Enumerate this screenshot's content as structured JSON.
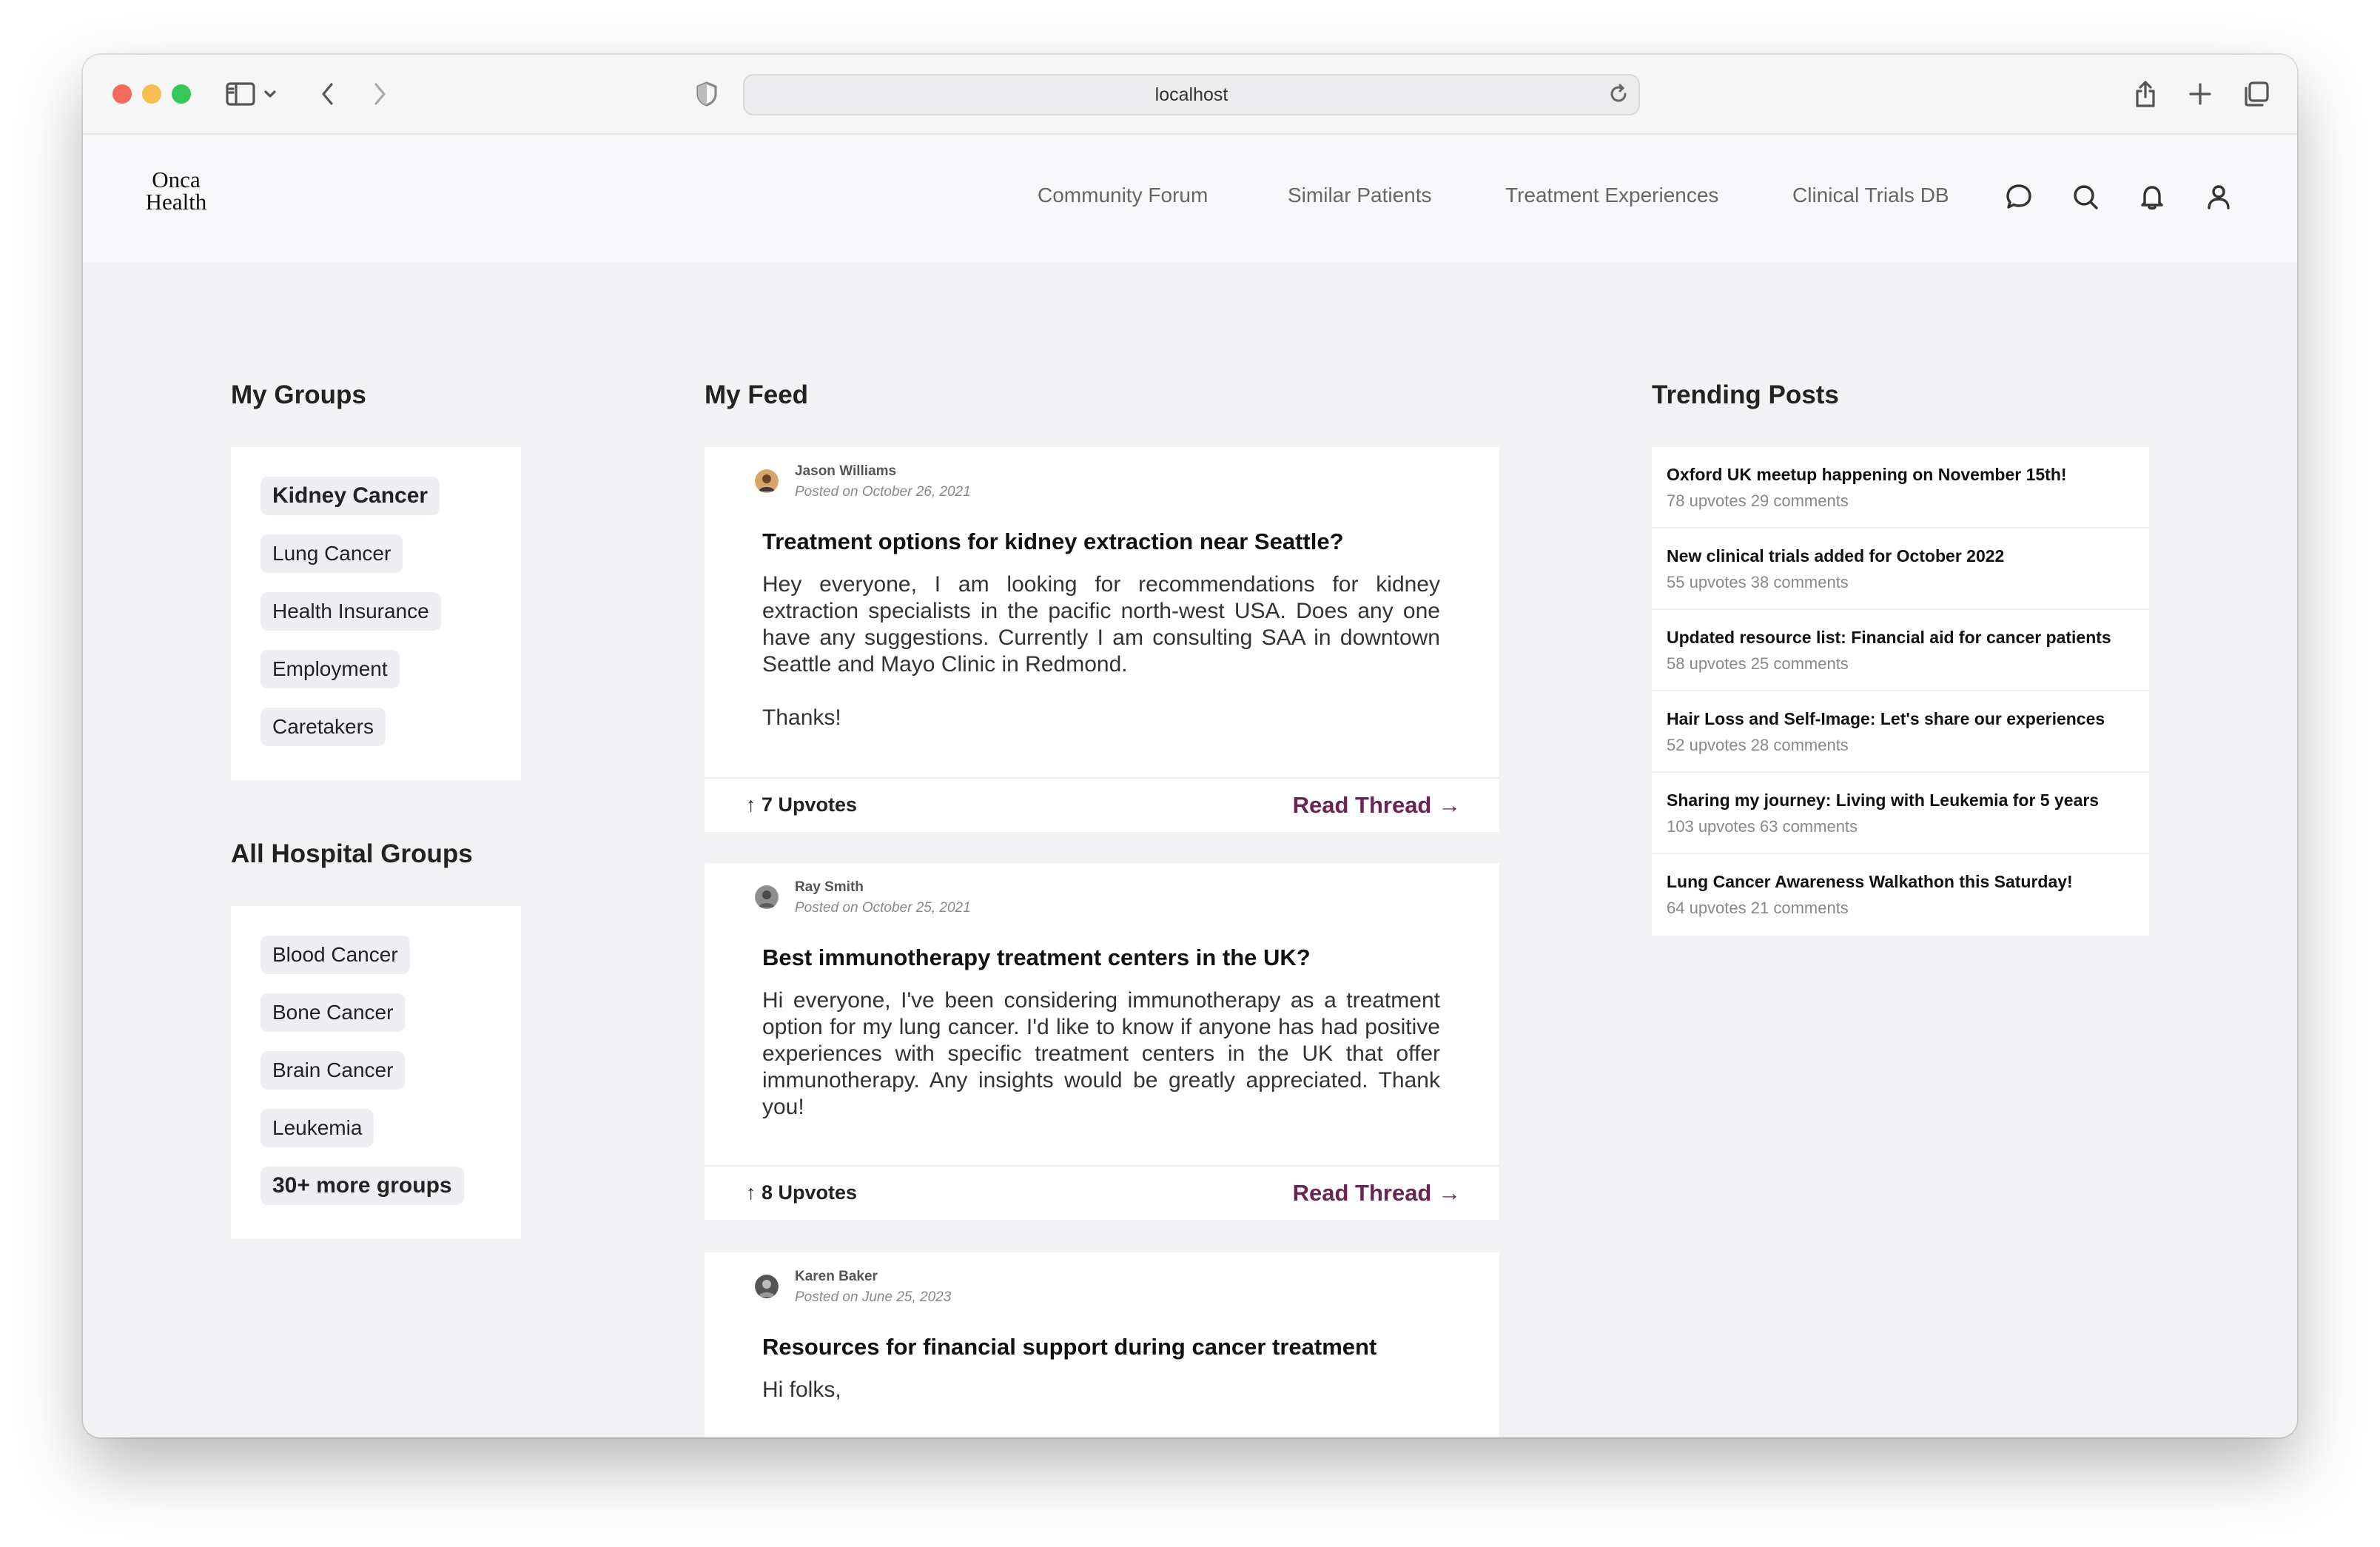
{
  "browser": {
    "url": "localhost"
  },
  "app": {
    "logo_line1": "Onca",
    "logo_line2": "Health",
    "nav": [
      "Community Forum",
      "Similar Patients",
      "Treatment Experiences",
      "Clinical Trials DB"
    ],
    "nav_icons": [
      "chat-icon",
      "search-icon",
      "bell-icon",
      "user-icon"
    ]
  },
  "my_groups": {
    "title": "My Groups",
    "items": [
      "Kidney Cancer",
      "Lung Cancer",
      "Health Insurance",
      "Employment",
      "Caretakers"
    ]
  },
  "hospital_groups": {
    "title": "All Hospital Groups",
    "items": [
      "Blood Cancer",
      "Bone Cancer",
      "Brain Cancer",
      "Leukemia"
    ],
    "more": "30+ more groups"
  },
  "feed": {
    "title": "My Feed",
    "posts": [
      {
        "author": "Jason Williams",
        "posted": "Posted on October 26, 2021",
        "title": "Treatment options for kidney extraction near Seattle?",
        "body": "Hey everyone, I am looking for recommendations for kidney extraction specialists in the pacific north-west USA. Does any one have any suggestions. Currently I am consulting SAA in downtown Seattle and Mayo Clinic in Redmond.",
        "body2": "Thanks!",
        "upvotes": "7 Upvotes",
        "read": "Read Thread"
      },
      {
        "author": "Ray Smith",
        "posted": "Posted on October 25, 2021",
        "title": "Best immunotherapy treatment centers in the UK?",
        "body": "Hi everyone, I've been considering immunotherapy as a treatment option for my lung cancer. I'd like to know if anyone has had positive experiences with specific treatment centers in the UK that offer immunotherapy. Any insights would be greatly appreciated. Thank you!",
        "upvotes": "8 Upvotes",
        "read": "Read Thread"
      },
      {
        "author": "Karen Baker",
        "posted": "Posted on June 25, 2023",
        "title": "Resources for financial support during cancer treatment",
        "body": "Hi folks,"
      }
    ]
  },
  "trending": {
    "title": "Trending Posts",
    "items": [
      {
        "title": "Oxford UK meetup happening on November 15th!",
        "meta": "78 upvotes 29 comments"
      },
      {
        "title": "New clinical trials added for October 2022",
        "meta": "55 upvotes 38 comments"
      },
      {
        "title": "Updated resource list: Financial aid for cancer patients",
        "meta": "58 upvotes 25 comments"
      },
      {
        "title": "Hair Loss and Self-Image: Let's share our experiences",
        "meta": "52 upvotes 28 comments"
      },
      {
        "title": "Sharing my journey: Living with Leukemia for 5 years",
        "meta": "103 upvotes 63 comments"
      },
      {
        "title": "Lung Cancer Awareness Walkathon this Saturday!",
        "meta": "64 upvotes 21 comments"
      }
    ]
  },
  "colors": {
    "accent": "#6b2452",
    "page_bg": "#f2f2f5",
    "chip_bg": "#eeeef2"
  }
}
